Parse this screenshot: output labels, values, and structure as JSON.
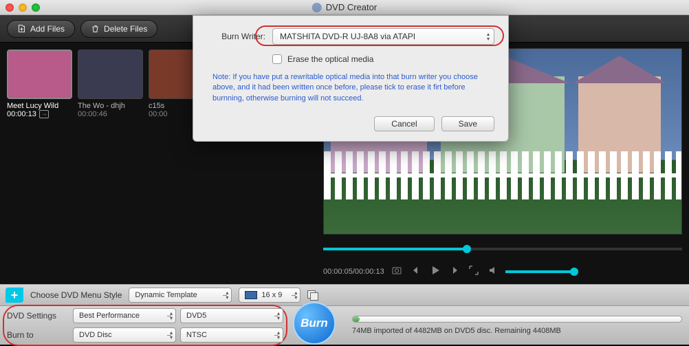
{
  "window": {
    "title": "DVD Creator"
  },
  "toolbar": {
    "add_files": "Add Files",
    "delete_files": "Delete Files"
  },
  "thumbs": [
    {
      "title": "Meet Lucy Wild",
      "time": "00:00:13"
    },
    {
      "title": "The Wo - dhjh",
      "time": "00:00:46"
    },
    {
      "title": "c15s",
      "time": "00:00"
    }
  ],
  "preview": {
    "time": "00:00:05/00:00:13"
  },
  "menu_strip": {
    "label": "Choose DVD Menu Style",
    "template": "Dynamic Template",
    "aspect": "16 x 9"
  },
  "settings": {
    "dvd_settings_label": "DVD Settings",
    "burn_to_label": "Burn to",
    "quality": "Best Performance",
    "disc_type": "DVD5",
    "burn_target": "DVD Disc",
    "tv_standard": "NTSC"
  },
  "burn": {
    "label": "Burn"
  },
  "progress": {
    "text": "74MB imported of 4482MB on DVD5 disc. Remaining 4408MB"
  },
  "modal": {
    "writer_label": "Burn Writer:",
    "writer_value": "MATSHITA DVD-R   UJ-8A8 via ATAPI",
    "erase_label": "Erase the optical media",
    "note": "Note: If you have put a rewritable optical media into that burn writer you choose above, and it had been written once before, please tick to erase it firt before burnning, otherwise burning will not succeed.",
    "cancel": "Cancel",
    "save": "Save"
  }
}
